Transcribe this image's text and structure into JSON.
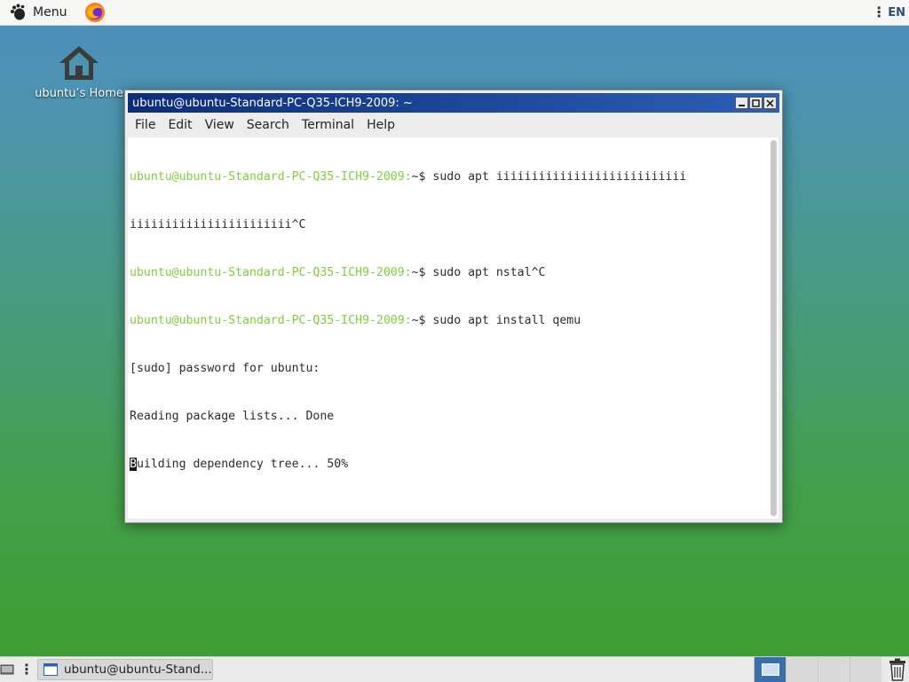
{
  "top_panel": {
    "menu_label": "Menu",
    "lang": "EN"
  },
  "desktop": {
    "home_label": "ubuntu’s Home"
  },
  "window": {
    "title": "ubuntu@ubuntu-Standard-PC-Q35-ICH9-2009: ~",
    "menus": [
      "File",
      "Edit",
      "View",
      "Search",
      "Terminal",
      "Help"
    ],
    "lines": [
      {
        "prompt": "ubuntu@ubuntu-Standard-PC-Q35-ICH9-2009:",
        "text": "~$ sudo apt iiiiiiiiiiiiiiiiiiiiiiiiiii"
      },
      {
        "prompt": "",
        "text": "iiiiiiiiiiiiiiiiiiiiiii^C"
      },
      {
        "prompt": "ubuntu@ubuntu-Standard-PC-Q35-ICH9-2009:",
        "text": "~$ sudo apt nstal^C"
      },
      {
        "prompt": "ubuntu@ubuntu-Standard-PC-Q35-ICH9-2009:",
        "text": "~$ sudo apt install qemu"
      },
      {
        "prompt": "",
        "text": "[sudo] password for ubuntu:"
      },
      {
        "prompt": "",
        "text": "Reading package lists... Done"
      },
      {
        "prompt": "",
        "text": "",
        "cursor_char": "B",
        "after_cursor": "uilding dependency tree... 50%"
      }
    ]
  },
  "taskbar": {
    "task_label": "ubuntu@ubuntu-Stand..."
  },
  "colors": {
    "prompt": "#7fcf3b",
    "titlebar": "#0c2d7a",
    "active_workspace": "#3a6ea8"
  }
}
